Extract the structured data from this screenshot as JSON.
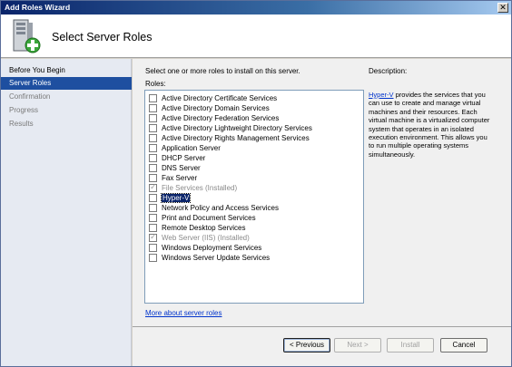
{
  "window": {
    "title": "Add Roles Wizard",
    "close_glyph": "✕"
  },
  "header": {
    "title": "Select Server Roles",
    "icon": "server-add-icon"
  },
  "nav": {
    "items": [
      {
        "label": "Before You Begin",
        "state": "normal"
      },
      {
        "label": "Server Roles",
        "state": "active"
      },
      {
        "label": "Confirmation",
        "state": "dim"
      },
      {
        "label": "Progress",
        "state": "dim"
      },
      {
        "label": "Results",
        "state": "dim"
      }
    ]
  },
  "main": {
    "instruction": "Select one or more roles to install on this server.",
    "roles_label": "Roles:",
    "roles": [
      {
        "label": "Active Directory Certificate Services",
        "checked": false,
        "disabled": false,
        "selected": false
      },
      {
        "label": "Active Directory Domain Services",
        "checked": false,
        "disabled": false,
        "selected": false
      },
      {
        "label": "Active Directory Federation Services",
        "checked": false,
        "disabled": false,
        "selected": false
      },
      {
        "label": "Active Directory Lightweight Directory Services",
        "checked": false,
        "disabled": false,
        "selected": false
      },
      {
        "label": "Active Directory Rights Management Services",
        "checked": false,
        "disabled": false,
        "selected": false
      },
      {
        "label": "Application Server",
        "checked": false,
        "disabled": false,
        "selected": false
      },
      {
        "label": "DHCP Server",
        "checked": false,
        "disabled": false,
        "selected": false
      },
      {
        "label": "DNS Server",
        "checked": false,
        "disabled": false,
        "selected": false
      },
      {
        "label": "Fax Server",
        "checked": false,
        "disabled": false,
        "selected": false
      },
      {
        "label": "File Services  (Installed)",
        "checked": true,
        "disabled": true,
        "selected": false
      },
      {
        "label": "Hyper-V",
        "checked": false,
        "disabled": false,
        "selected": true
      },
      {
        "label": "Network Policy and Access Services",
        "checked": false,
        "disabled": false,
        "selected": false
      },
      {
        "label": "Print and Document Services",
        "checked": false,
        "disabled": false,
        "selected": false
      },
      {
        "label": "Remote Desktop Services",
        "checked": false,
        "disabled": false,
        "selected": false
      },
      {
        "label": "Web Server (IIS)  (Installed)",
        "checked": true,
        "disabled": true,
        "selected": false
      },
      {
        "label": "Windows Deployment Services",
        "checked": false,
        "disabled": false,
        "selected": false
      },
      {
        "label": "Windows Server Update Services",
        "checked": false,
        "disabled": false,
        "selected": false
      }
    ],
    "description_label": "Description:",
    "description_link": "Hyper-V",
    "description_text": " provides the services that you can use to create and manage virtual machines and their resources. Each virtual machine is a virtualized computer system that operates in an isolated execution environment. This allows you to run multiple operating systems simultaneously.",
    "more_link": "More about server roles"
  },
  "footer": {
    "previous": "< Previous",
    "next": "Next >",
    "install": "Install",
    "cancel": "Cancel"
  }
}
